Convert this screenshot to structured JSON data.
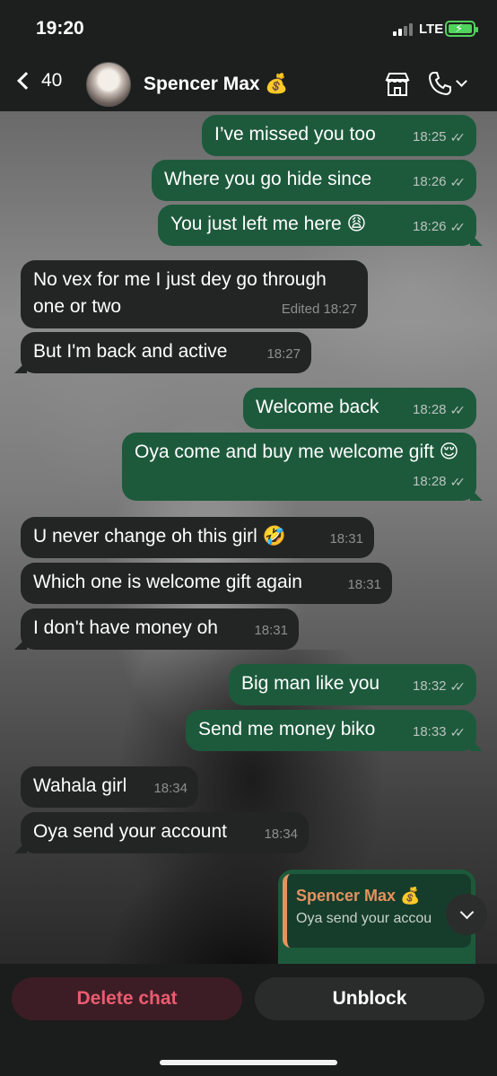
{
  "status_bar": {
    "time": "19:20",
    "network": "LTE"
  },
  "header": {
    "back_count": "40",
    "contact_name": "Spencer Max 💰"
  },
  "messages": [
    {
      "dir": "out",
      "text": "I’ve missed you too",
      "time": "18:25"
    },
    {
      "dir": "out",
      "text": "Where you go hide since",
      "time": "18:26"
    },
    {
      "dir": "out",
      "text": "You just left me here 😩",
      "time": "18:26"
    },
    {
      "dir": "in",
      "text": "No vex for me I just dey go through one or two",
      "time": "Edited 18:27"
    },
    {
      "dir": "in",
      "text": "But I'm back and active",
      "time": "18:27"
    },
    {
      "dir": "out",
      "text": "Welcome back",
      "time": "18:28"
    },
    {
      "dir": "out",
      "text": "Oya come and buy me welcome gift 😌",
      "time": "18:28"
    },
    {
      "dir": "in",
      "text": "U never change oh this girl 🤣",
      "time": "18:31"
    },
    {
      "dir": "in",
      "text": "Which one is welcome gift again",
      "time": "18:31"
    },
    {
      "dir": "in",
      "text": "I don't have money oh",
      "time": "18:31"
    },
    {
      "dir": "out",
      "text": "Big man like you",
      "time": "18:32"
    },
    {
      "dir": "out",
      "text": "Send me money biko",
      "time": "18:33"
    },
    {
      "dir": "in",
      "text": "Wahala girl",
      "time": "18:34"
    },
    {
      "dir": "in",
      "text": "Oya send your account",
      "time": "18:34"
    }
  ],
  "reply_preview": {
    "name": "Spencer Max 💰",
    "text": "Oya send your accou"
  },
  "bottom_bar": {
    "delete_label": "Delete chat",
    "unblock_label": "Unblock"
  },
  "colors": {
    "outgoing": "#1d5a3c",
    "incoming": "#232524",
    "delete": "#ec5b6f",
    "reply_name": "#e5925f"
  }
}
